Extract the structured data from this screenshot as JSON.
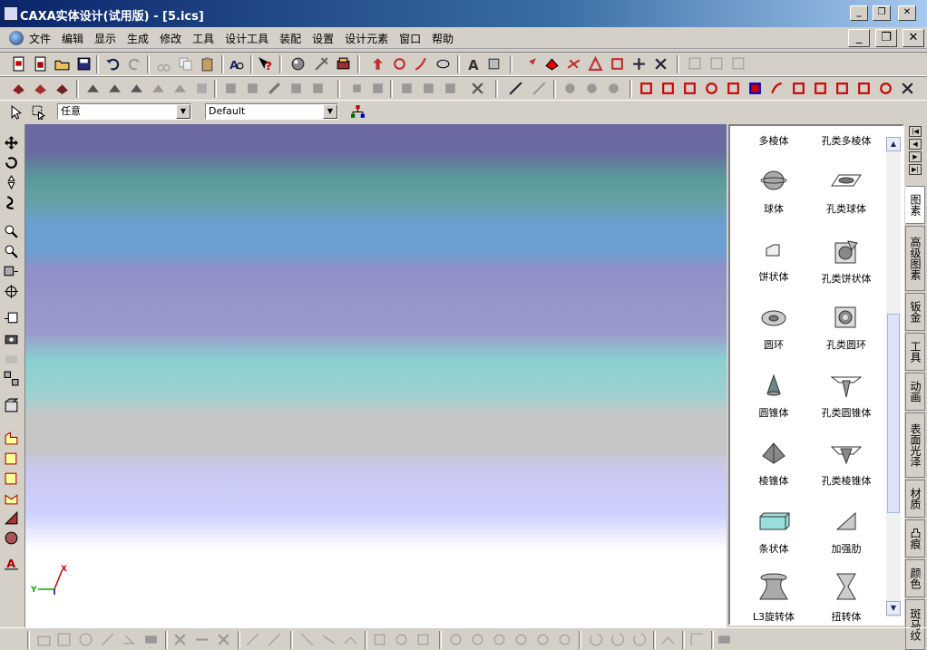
{
  "window": {
    "title": "CAXA实体设计(试用版) - [5.ics]"
  },
  "menubar": {
    "items": [
      "文件",
      "编辑",
      "显示",
      "生成",
      "修改",
      "工具",
      "设计工具",
      "装配",
      "设置",
      "设计元素",
      "窗口",
      "帮助"
    ]
  },
  "selection": {
    "filter_value": "任意",
    "style_value": "Default"
  },
  "viewport": {
    "axis_x_label": "X",
    "axis_y_label": "Y"
  },
  "library": {
    "top_partial": [
      "多棱体",
      "孔类多棱体"
    ],
    "items": [
      {
        "label": "球体",
        "icon": "sphere-icon"
      },
      {
        "label": "孔类球体",
        "icon": "hole-sphere-icon"
      },
      {
        "label": "饼状体",
        "icon": "pie-icon"
      },
      {
        "label": "孔类饼状体",
        "icon": "hole-pie-icon"
      },
      {
        "label": "圆环",
        "icon": "torus-icon"
      },
      {
        "label": "孔类圆环",
        "icon": "hole-torus-icon"
      },
      {
        "label": "圆锥体",
        "icon": "cone-icon"
      },
      {
        "label": "孔类圆锥体",
        "icon": "hole-cone-icon"
      },
      {
        "label": "棱锥体",
        "icon": "pyramid-icon"
      },
      {
        "label": "孔类棱锥体",
        "icon": "hole-pyramid-icon"
      },
      {
        "label": "条状体",
        "icon": "bar-icon"
      },
      {
        "label": "加强肋",
        "icon": "rib-icon"
      },
      {
        "label": "L3旋转体",
        "icon": "revolve-icon"
      },
      {
        "label": "扭转体",
        "icon": "twist-icon"
      }
    ]
  },
  "tabs": [
    "图素",
    "高级图素",
    "钣金",
    "工具",
    "动画",
    "表面光泽",
    "材质",
    "凸痕",
    "颜色",
    "斑马纹"
  ]
}
